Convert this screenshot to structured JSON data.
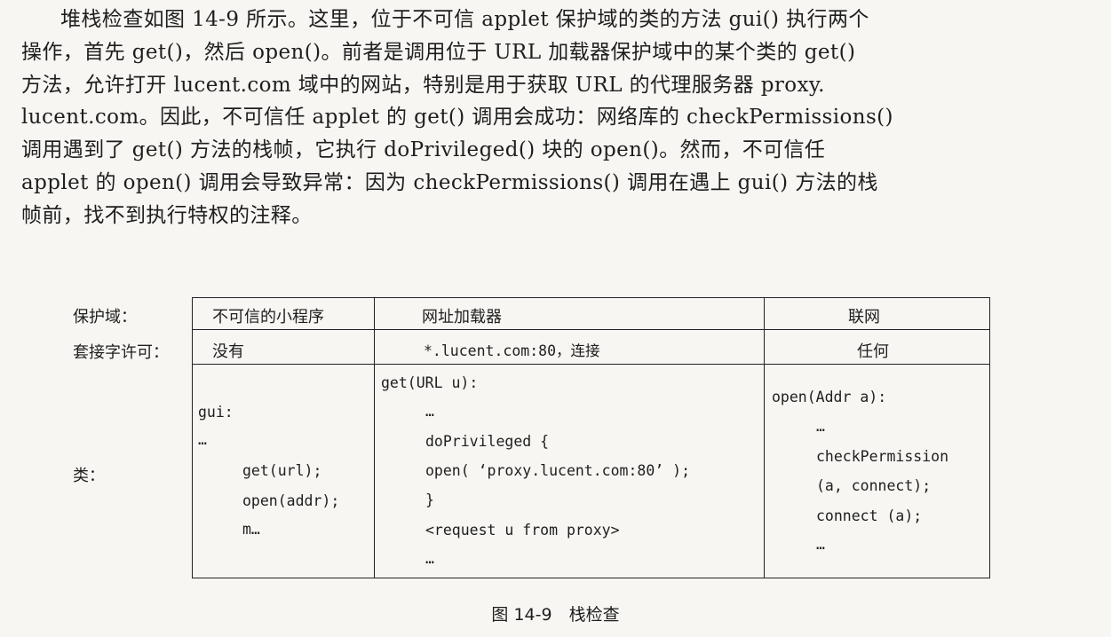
{
  "paragraph": [
    "堆栈检查如图 14-9 所示。这里，位于不可信 applet 保护域的类的方法 gui() 执行两个",
    "操作，首先 get()，然后 open()。前者是调用位于 URL 加载器保护域中的某个类的 get()",
    "方法，允许打开 lucent.com 域中的网站，特别是用于获取 URL 的代理服务器 proxy.",
    "lucent.com。因此，不可信任 applet 的 get() 调用会成功：网络库的 checkPermissions()",
    "调用遇到了 get() 方法的栈帧，它执行 doPrivileged() 块的 open()。然而，不可信任",
    "applet 的 open() 调用会导致异常：因为 checkPermissions() 调用在遇上 gui() 方法的栈",
    "帧前，找不到执行特权的注释。"
  ],
  "figure": {
    "row_labels": {
      "domain": "保护域：",
      "socket": "套接字许可：",
      "classes": "类："
    },
    "columns": [
      {
        "domain": "不可信的小程序",
        "permission": "没有",
        "code": [
          "gui:",
          "…",
          "get(url);",
          "open(addr);",
          "m…"
        ]
      },
      {
        "domain": "网址加载器",
        "permission": "*.lucent.com:80，连接",
        "code": [
          "get(URL u):",
          "…",
          "doPrivileged {",
          "open( ‘proxy.lucent.com:80’ );",
          "}",
          "<request u from proxy>",
          "…"
        ]
      },
      {
        "domain": "联网",
        "permission": "任何",
        "code": [
          "open(Addr a):",
          "…",
          "checkPermission",
          "(a, connect);",
          "connect (a);",
          "…"
        ]
      }
    ],
    "caption": "图 14-9　栈检查"
  }
}
